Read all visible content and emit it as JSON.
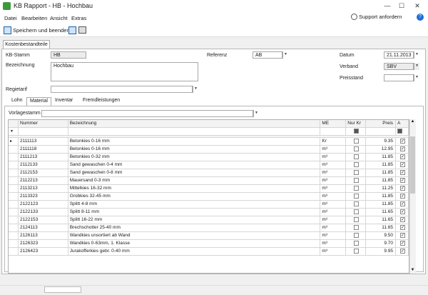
{
  "window": {
    "title": "KB Rapport - HB - Hochbau",
    "minimize": "—",
    "maximize": "☐",
    "close": "✕"
  },
  "menu": {
    "datei": "Datei",
    "bearbeiten": "Bearbeiten",
    "ansicht": "Ansicht",
    "extras": "Extras",
    "support": "Support anfordern",
    "help": "?"
  },
  "toolbar": {
    "save_close": "Speichern und beenden"
  },
  "main_tab": "Kostenbestandteile",
  "form": {
    "kb_stamm_label": "KB-Stamm",
    "kb_stamm_value": "HB",
    "bezeichnung_label": "Bezeichnung",
    "bezeichnung_value": "Hochbau",
    "regietarif_label": "Regietarif",
    "regietarif_value": "",
    "referenz_label": "Referenz",
    "referenz_value": "AB",
    "datum_label": "Datum",
    "datum_value": "21.11.2013",
    "verband_label": "Verband",
    "verband_value": "SBV",
    "preisstand_label": "Preisstand",
    "preisstand_value": ""
  },
  "sub_tabs": [
    "Lohn",
    "Material",
    "Inventar",
    "Fremdleistungen"
  ],
  "vorlagestamm_label": "Vorlagestamm",
  "grid": {
    "headers": {
      "nummer": "Nummer",
      "bezeichnung": "Bezeichnung",
      "me": "ME",
      "nur_kr": "Nur Kr",
      "preis": "Preis",
      "a": "A"
    },
    "rows": [
      {
        "nummer": "2111113",
        "bezeichnung": "Betonkies 0-16 mm",
        "me": "Kr",
        "preis": "9.35"
      },
      {
        "nummer": "2111118",
        "bezeichnung": "Betonkies 0-16 mm",
        "me": "m³",
        "preis": "12.95"
      },
      {
        "nummer": "2111213",
        "bezeichnung": "Betonkies 0-32 mm",
        "me": "m³",
        "preis": "11.85"
      },
      {
        "nummer": "2112133",
        "bezeichnung": "Sand gewaschen 0-4 mm",
        "me": "m³",
        "preis": "11.85"
      },
      {
        "nummer": "2112153",
        "bezeichnung": "Sand gewaschen 0-8 mm",
        "me": "m³",
        "preis": "11.85"
      },
      {
        "nummer": "2112213",
        "bezeichnung": "Mauersand 0-3 mm",
        "me": "m³",
        "preis": "11.85"
      },
      {
        "nummer": "2113213",
        "bezeichnung": "Mittelkies 16-32 mm",
        "me": "m³",
        "preis": "11.25"
      },
      {
        "nummer": "2113323",
        "bezeichnung": "Grobkies 32-45 mm",
        "me": "m³",
        "preis": "11.85"
      },
      {
        "nummer": "2122123",
        "bezeichnung": "Splitt 4-8 mm",
        "me": "m³",
        "preis": "11.85"
      },
      {
        "nummer": "2122133",
        "bezeichnung": "Splitt  8-11 mm",
        "me": "m³",
        "preis": "11.65"
      },
      {
        "nummer": "2122153",
        "bezeichnung": "Splitt 16-22 mm",
        "me": "m³",
        "preis": "11.65"
      },
      {
        "nummer": "2124113",
        "bezeichnung": "Brechschotter  25-40 mm",
        "me": "m³",
        "preis": "11.65"
      },
      {
        "nummer": "2126113",
        "bezeichnung": "Wandkies unsortiert ab Wand",
        "me": "m³",
        "preis": "9.50"
      },
      {
        "nummer": "2126323",
        "bezeichnung": "Wandkies 0-63mm,  1. Klasse",
        "me": "m³",
        "preis": "9.70"
      },
      {
        "nummer": "2126423",
        "bezeichnung": "Jurakofferkies gebr. 0-40 mm",
        "me": "m³",
        "preis": "9.95"
      }
    ]
  }
}
